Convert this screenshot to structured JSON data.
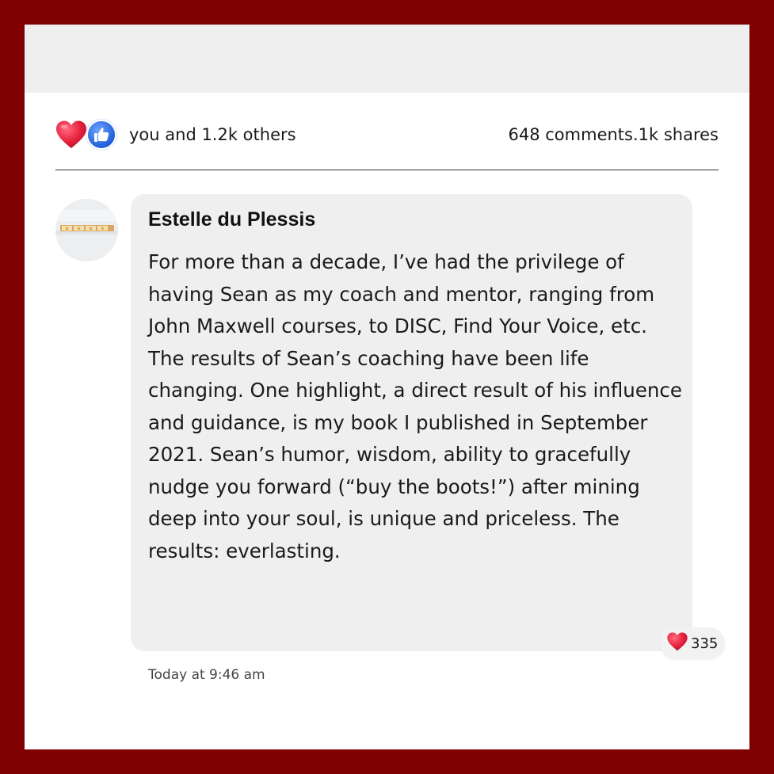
{
  "post": {
    "reactions": {
      "icons": [
        "heart-icon",
        "like-icon"
      ],
      "reactor_text": "you and 1.2k others",
      "stats_text": "648 comments.1k shares"
    }
  },
  "comment": {
    "author": "Estelle du Plessis",
    "avatar_icon": "five-star-rating-icon",
    "text": "For more than a decade, I’ve had the privilege of having Sean as my coach and mentor, ranging from John Maxwell courses, to DISC, Find Your Voice, etc. The results of Sean’s coaching have been life changing. One highlight, a direct result of his influence and guidance, is my book I published in September 2021. Sean’s humor, wisdom, ability to gracefully nudge you forward (“buy the boots!”) after mining deep into your soul, is unique and priceless. The results: everlasting.",
    "reaction_count": "335",
    "timestamp": "Today at 9:46 am"
  },
  "colors": {
    "frame": "#7e0000",
    "heart": "#e8233f",
    "like": "#2d6fe0",
    "bubble": "#efefef"
  }
}
